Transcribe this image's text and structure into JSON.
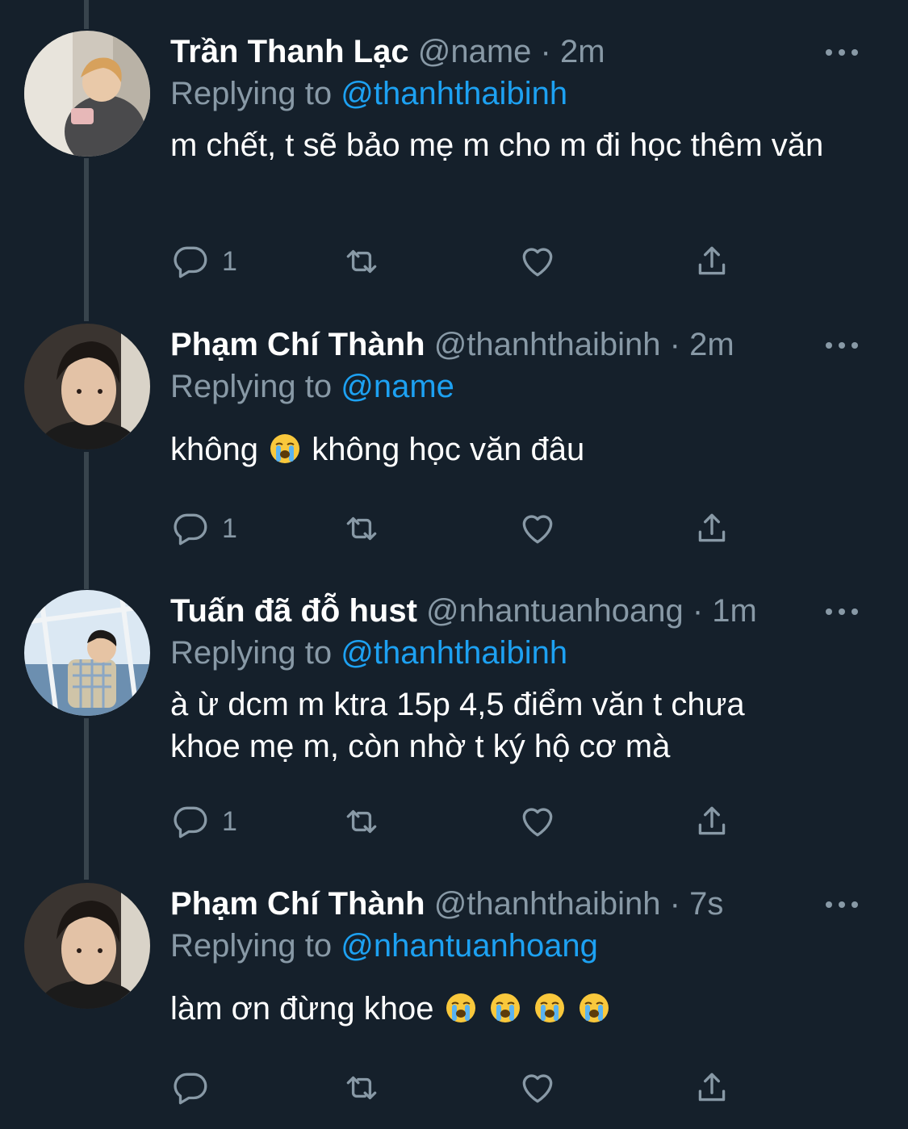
{
  "colors": {
    "background": "#15202b",
    "text": "#ffffff",
    "muted": "#8899a6",
    "accent": "#1da1f2",
    "thread_line": "#38444d"
  },
  "tweets": [
    {
      "name": "Trần Thanh Lạc",
      "handle": "@name",
      "dot": "·",
      "time": "2m",
      "replying_label": "Replying to",
      "replying_to": "@thanhthaibinh",
      "text": "m chết, t sẽ bảo mẹ m cho m đi học thêm văn",
      "reply_count": "1",
      "avatar_icon": "avatar-photo"
    },
    {
      "name": "Phạm Chí Thành",
      "handle": "@thanhthaibinh",
      "dot": "·",
      "time": "2m",
      "replying_label": "Replying to",
      "replying_to": "@name",
      "text_before": "không",
      "text_after": "không học văn đâu",
      "reply_count": "1",
      "avatar_icon": "avatar-photo"
    },
    {
      "name": "Tuấn đã đỗ hust",
      "handle": "@nhantuanhoang",
      "dot": "·",
      "time": "1m",
      "replying_label": "Replying to",
      "replying_to": "@thanhthaibinh",
      "text": "à ừ dcm m ktra 15p 4,5 điểm văn t chưa khoe mẹ m, còn nhờ t ký hộ cơ mà",
      "reply_count": "1",
      "avatar_icon": "avatar-photo"
    },
    {
      "name": "Phạm Chí Thành",
      "handle": "@thanhthaibinh",
      "dot": "·",
      "time": "7s",
      "replying_label": "Replying to",
      "replying_to": "@nhantuanhoang",
      "text": "làm ơn đừng khoe",
      "reply_count": "",
      "avatar_icon": "avatar-photo"
    }
  ],
  "icons": {
    "reply": "reply-icon",
    "retweet": "retweet-icon",
    "like": "heart-icon",
    "share": "share-icon",
    "more": "more-icon",
    "emoji": "loudly-crying-face-emoji"
  }
}
